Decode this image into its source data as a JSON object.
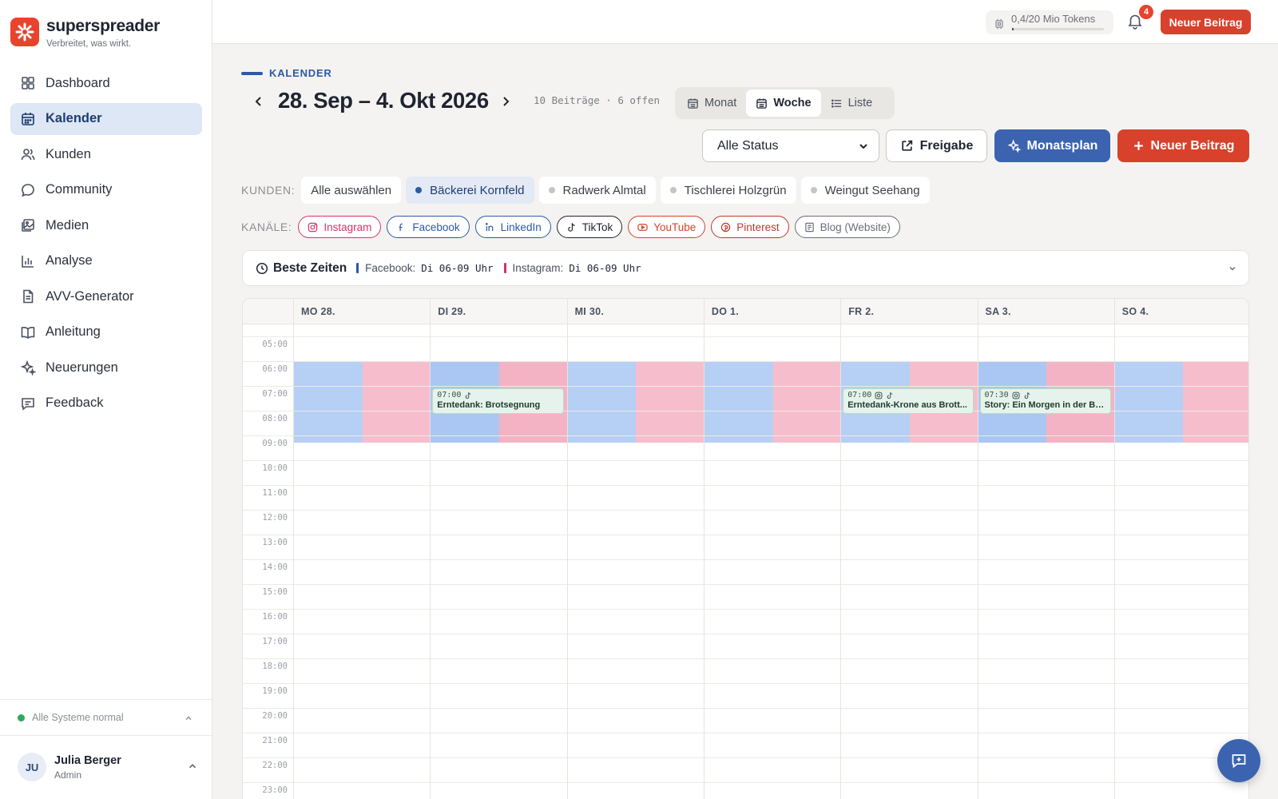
{
  "brand": {
    "name": "superspreader",
    "tagline": "Verbreitet, was wirkt."
  },
  "sidebar": {
    "items": [
      {
        "label": "Dashboard",
        "icon": "grid-icon",
        "active": false
      },
      {
        "label": "Kalender",
        "icon": "calendar-icon",
        "active": true
      },
      {
        "label": "Kunden",
        "icon": "users-icon",
        "active": false
      },
      {
        "label": "Community",
        "icon": "chat-icon",
        "active": false
      },
      {
        "label": "Medien",
        "icon": "images-icon",
        "active": false
      },
      {
        "label": "Analyse",
        "icon": "bar-chart-icon",
        "active": false
      },
      {
        "label": "AVV-Generator",
        "icon": "document-icon",
        "active": false
      },
      {
        "label": "Anleitung",
        "icon": "book-icon",
        "active": false
      },
      {
        "label": "Neuerungen",
        "icon": "sparkle-icon",
        "active": false
      },
      {
        "label": "Feedback",
        "icon": "feedback-icon",
        "active": false
      }
    ],
    "system_status": "Alle Systeme normal",
    "user": {
      "initials": "JU",
      "name": "Julia Berger",
      "role": "Admin"
    }
  },
  "topbar": {
    "tokens": "0,4/20 Mio Tokens",
    "tokens_used_fraction": 0.02,
    "notifications": "4",
    "new_post": "Neuer Beitrag"
  },
  "header": {
    "eyebrow": "KALENDER",
    "title": "28. Sep – 4. Okt 2026",
    "meta": "10 Beiträge · 6 offen",
    "views": [
      "Monat",
      "Woche",
      "Liste"
    ],
    "active_view": "Woche",
    "status_filter": "Alle Status",
    "freigabe": "Freigabe",
    "monatsplan": "Monatsplan",
    "new_post": "Neuer Beitrag"
  },
  "filters": {
    "kunden_label": "KUNDEN:",
    "kunden": [
      "Alle auswählen",
      "Bäckerei Kornfeld",
      "Radwerk Almtal",
      "Tischlerei Holzgrün",
      "Weingut Seehang"
    ],
    "active_kunde": "Bäckerei Kornfeld",
    "kanaele_label": "KANÄLE:",
    "kanaele": [
      {
        "label": "Instagram",
        "color": "#d6336c",
        "icon": "instagram-icon"
      },
      {
        "label": "Facebook",
        "color": "#2b5aa7",
        "icon": "facebook-icon"
      },
      {
        "label": "LinkedIn",
        "color": "#2b5aa7",
        "icon": "linkedin-icon"
      },
      {
        "label": "TikTok",
        "color": "#1f2430",
        "icon": "tiktok-icon"
      },
      {
        "label": "YouTube",
        "color": "#d8412b",
        "icon": "youtube-icon"
      },
      {
        "label": "Pinterest",
        "color": "#c0392b",
        "icon": "pinterest-icon"
      },
      {
        "label": "Blog (Website)",
        "color": "#6b6f78",
        "icon": "blog-icon"
      }
    ]
  },
  "best_times": {
    "title": "Beste Zeiten",
    "entries": [
      {
        "channel": "Facebook:",
        "value": "Di 06-09 Uhr",
        "color": "#2b5aa7"
      },
      {
        "channel": "Instagram:",
        "value": "Di 06-09 Uhr",
        "color": "#d6336c"
      }
    ]
  },
  "calendar": {
    "days": [
      "MO 28.",
      "DI 29.",
      "MI 30.",
      "DO 1.",
      "FR 2.",
      "SA 3.",
      "SO 4."
    ],
    "hours": [
      "05:00",
      "06:00",
      "07:00",
      "08:00",
      "09:00",
      "10:00",
      "11:00",
      "12:00",
      "13:00",
      "14:00",
      "15:00",
      "16:00",
      "17:00",
      "18:00",
      "19:00",
      "20:00",
      "21:00",
      "22:00",
      "23:00"
    ],
    "events": [
      {
        "day": 1,
        "time": "07:00",
        "title": "Erntedank: Brotsegnung",
        "icons": [
          "tiktok-icon"
        ]
      },
      {
        "day": 4,
        "time": "07:00",
        "title": "Erntedank-Krone aus Brott...",
        "icons": [
          "instagram-icon",
          "tiktok-icon"
        ]
      },
      {
        "day": 5,
        "time": "07:30",
        "title": "Story: Ein Morgen in der Ba...",
        "icons": [
          "instagram-icon",
          "tiktok-icon"
        ]
      }
    ],
    "facebook_color": "#a9c7f2",
    "instagram_color": "#f4b3c4"
  }
}
